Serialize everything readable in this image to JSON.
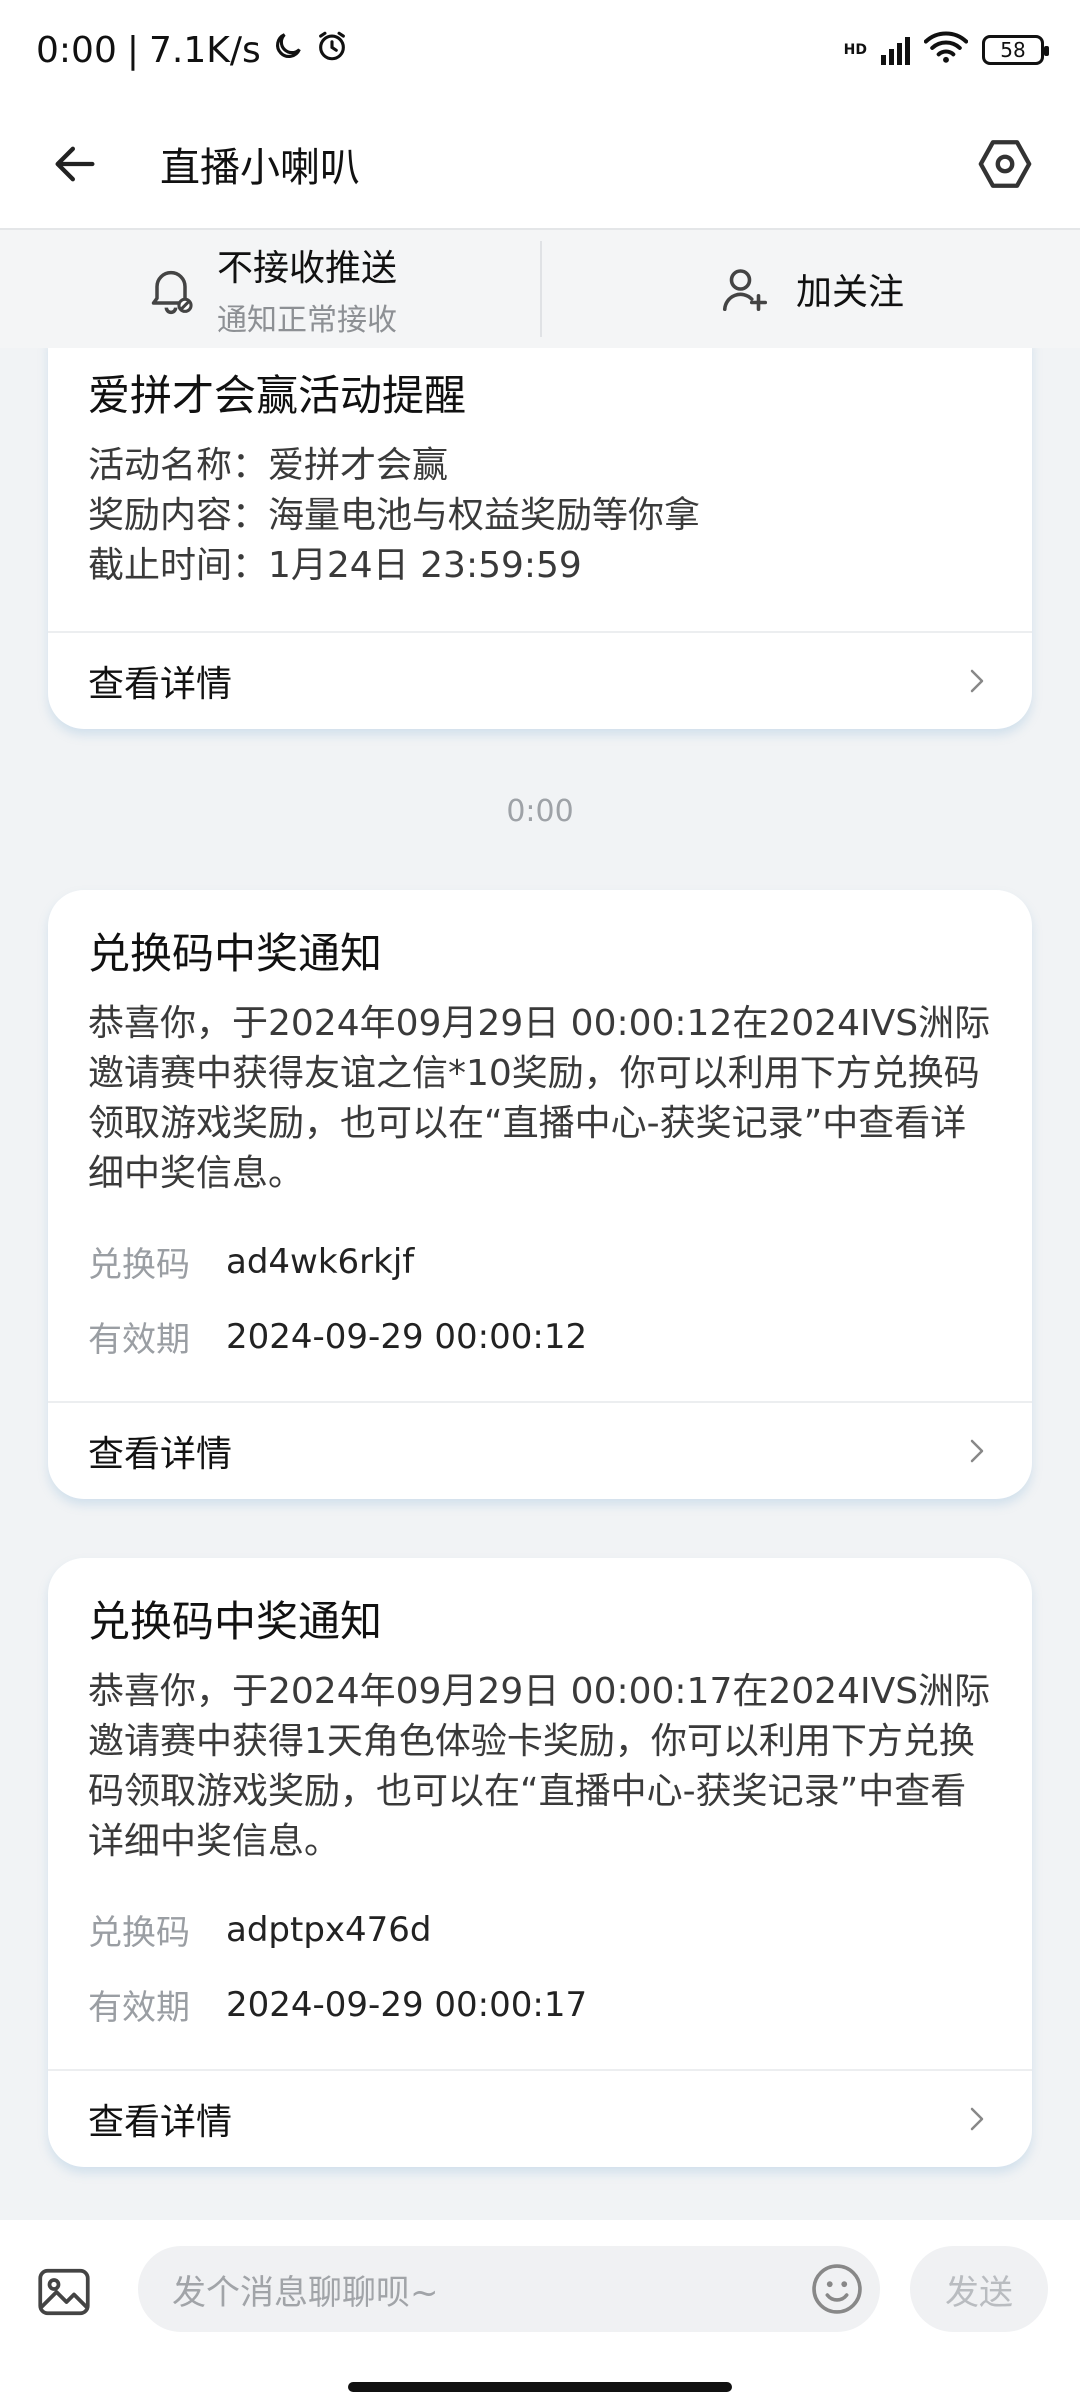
{
  "status_bar": {
    "time": "0:00",
    "net_speed": "7.1K/s",
    "hd_label": "HD",
    "battery": "58"
  },
  "header": {
    "title": "直播小喇叭"
  },
  "subscribe_bar": {
    "left_main": "不接收推送",
    "left_secondary": "通知正常接收",
    "right_label": "加关注"
  },
  "cards": [
    {
      "title": "爱拼才会赢活动提醒",
      "lines": [
        "活动名称：爱拼才会赢",
        "奖励内容：海量电池与权益奖励等你拿",
        "截止时间：1月24日 23:59:59"
      ],
      "footer_label": "查看详情"
    },
    {
      "title": "兑换码中奖通知",
      "text_lines": [
        "恭喜你，于2024年09月29日 00:00:12在2024IVS洲际",
        "邀请赛中获得友谊之信*10奖励，你可以利用下方兑换码",
        "领取游戏奖励，也可以在“直播中心-获奖记录”中查看详",
        "细中奖信息。"
      ],
      "code_label": "兑换码",
      "code_value": "ad4wk6rkjf",
      "valid_label": "有效期",
      "valid_value": "2024-09-29 00:00:12",
      "footer_label": "查看详情"
    },
    {
      "title": "兑换码中奖通知",
      "text_lines": [
        "恭喜你，于2024年09月29日 00:00:17在2024IVS洲际",
        "邀请赛中获得1天角色体验卡奖励，你可以利用下方兑换",
        "码领取游戏奖励，也可以在“直播中心-获奖记录”中查看",
        "详细中奖信息。"
      ],
      "code_label": "兑换码",
      "code_value": "adptpx476d",
      "valid_label": "有效期",
      "valid_value": "2024-09-29 00:00:17",
      "footer_label": "查看详情"
    }
  ],
  "timestamp": "0:00",
  "composer": {
    "placeholder": "发个消息聊聊呗~",
    "send_label": "发送"
  }
}
